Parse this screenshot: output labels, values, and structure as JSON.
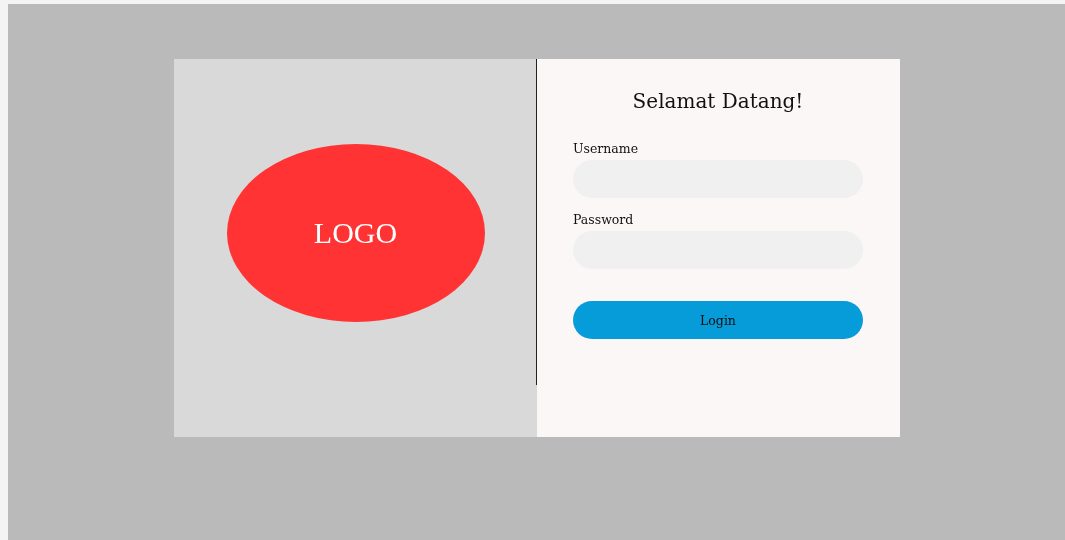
{
  "logo": {
    "text": "LOGO"
  },
  "login": {
    "title": "Selamat Datang!",
    "fields": [
      {
        "label": "Username"
      },
      {
        "label": "Password"
      }
    ],
    "button": "Login"
  }
}
